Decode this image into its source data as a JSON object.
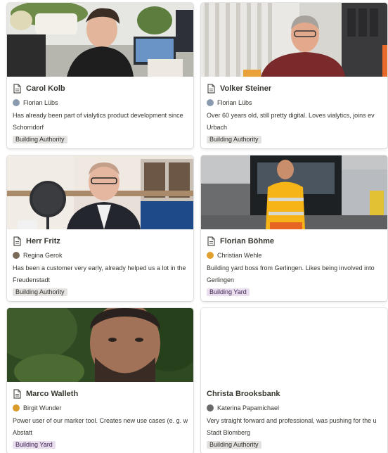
{
  "colors": {
    "tag_authority_bg": "#e3e2e0",
    "tag_yard_bg": "#e8deee"
  },
  "cards": [
    {
      "title": "Carol Kolb",
      "has_page_icon": true,
      "person": "Florian Lübs",
      "avatar_color": "#8a9bb0",
      "description": "Has already been part of vialytics product development since",
      "city": "Schorndorf",
      "tag": "Building Authority",
      "tag_kind": "authority"
    },
    {
      "title": "Volker Steiner",
      "has_page_icon": true,
      "person": "Florian Lübs",
      "avatar_color": "#8a9bb0",
      "description": "Over 60 years old, still pretty digital. Loves vialytics, joins ev",
      "city": "Urbach",
      "tag": "Building Authority",
      "tag_kind": "authority"
    },
    {
      "title": "Herr Fritz",
      "has_page_icon": true,
      "person": "Regina Gerok",
      "avatar_color": "#7a6a5a",
      "description": "Has been a customer very early, already helped us a lot in the",
      "city": "Freudenstadt",
      "tag": "Building Authority",
      "tag_kind": "authority"
    },
    {
      "title": "Florian Böhme",
      "has_page_icon": true,
      "person": "Christian Wehle",
      "avatar_color": "#e0a030",
      "description": "Building yard boss from Gerlingen. Likes being involved into",
      "city": "Gerlingen",
      "tag": "Building Yard",
      "tag_kind": "yard"
    },
    {
      "title": "Marco Walleth",
      "has_page_icon": true,
      "person": "Birgit Wunder",
      "avatar_color": "#d89a2a",
      "description": "Power user of our marker tool. Creates new use cases (e. g. w",
      "city": "Abstatt",
      "tag": "Building Yard",
      "tag_kind": "yard"
    },
    {
      "title": "Christa Brooksbank",
      "has_page_icon": false,
      "person": "Katerina Papamichael",
      "avatar_color": "#6a6a6a",
      "description": "Very straight forward and professional, was pushing for the u",
      "city": "Stadt Blomberg",
      "tag": "Building Authority",
      "tag_kind": "authority"
    }
  ]
}
